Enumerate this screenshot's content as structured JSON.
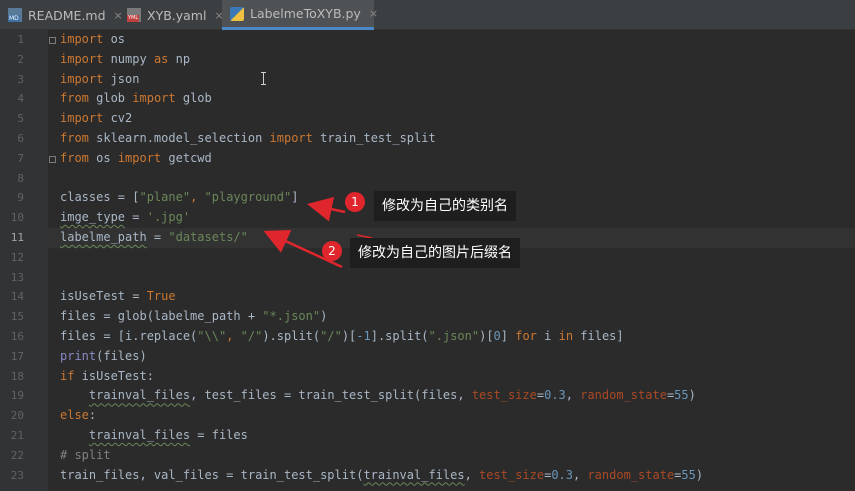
{
  "tabs": [
    {
      "label": "README.md",
      "icon": "markdown-file-icon",
      "active": false
    },
    {
      "label": "XYB.yaml",
      "icon": "yaml-file-icon",
      "active": false
    },
    {
      "label": "LabelmeToXYB.py",
      "icon": "python-file-icon",
      "active": true
    }
  ],
  "tab_close_glyph": "×",
  "line_numbers": [
    "1",
    "2",
    "3",
    "4",
    "5",
    "6",
    "7",
    "8",
    "9",
    "10",
    "11",
    "12",
    "13",
    "14",
    "15",
    "16",
    "17",
    "18",
    "19",
    "20",
    "21",
    "22",
    "23"
  ],
  "current_line": 11,
  "code": {
    "l1": {
      "kw1": "import",
      "t1": " os"
    },
    "l2": {
      "kw1": "import",
      "t1": " numpy ",
      "kw2": "as",
      "t2": " np"
    },
    "l3": {
      "kw1": "import",
      "t1": " json"
    },
    "l4": {
      "kw1": "from",
      "t1": " glob ",
      "kw2": "import",
      "t2": " glob"
    },
    "l5": {
      "kw1": "import",
      "t1": " cv2"
    },
    "l6": {
      "kw1": "from",
      "t1": " sklearn.model_selection ",
      "kw2": "import",
      "t2": " train_test_split"
    },
    "l7": {
      "kw1": "from",
      "t1": " os ",
      "kw2": "import",
      "t2": " getcwd"
    },
    "l9": {
      "t1": "classes = [",
      "s1": "\"plane\"",
      "p1": ", ",
      "s2": "\"playground\"",
      "t2": "]"
    },
    "l10": {
      "t1": "imge_type",
      "t2": " = ",
      "s1": "'.jpg'"
    },
    "l11": {
      "t1": "labelme_path",
      "t2": " = ",
      "s1": "\"datasets/\""
    },
    "l14": {
      "t1": "isUseTest = ",
      "kw1": "True"
    },
    "l15": {
      "t1": "files = glob(labelme_path + ",
      "s1": "\"*.json\"",
      "t2": ")"
    },
    "l16": {
      "t1": "files = [i.replace(",
      "s1": "\"\\\\\"",
      "p1": ", ",
      "s2": "\"/\"",
      "t2": ").split(",
      "s3": "\"/\"",
      "t3": ")[",
      "n1": "-1",
      "t4": "].split(",
      "s4": "\".json\"",
      "t5": ")[",
      "n2": "0",
      "t6": "] ",
      "kw1": "for",
      "t7": " i ",
      "kw2": "in",
      "t8": " files]"
    },
    "l17": {
      "b1": "print",
      "t1": "(files)"
    },
    "l18": {
      "kw1": "if",
      "t1": " isUseTest:"
    },
    "l19": {
      "i1": "    ",
      "t1": "trainval_files",
      "t2": ", test_files = train_test_split(files, ",
      "kw1": "test_size",
      "t3": "=",
      "n1": "0.3",
      "t4": ", ",
      "kw2": "random_state",
      "t5": "=",
      "n2": "55",
      "t6": ")"
    },
    "l20": {
      "kw1": "else",
      "t1": ":"
    },
    "l21": {
      "i1": "    ",
      "t1": "trainval_files",
      "t2": " = files"
    },
    "l22": {
      "c1": "# split"
    },
    "l23": {
      "t1": "train_files, val_files = train_test_split(",
      "t2": "trainval_files",
      "t3": ", ",
      "kw1": "test_size",
      "t4": "=",
      "n1": "0.3",
      "t5": ", ",
      "kw2": "random_state",
      "t6": "=",
      "n2": "55",
      "t7": ")"
    }
  },
  "annotations": [
    {
      "number": "1",
      "text": "修改为自己的类别名"
    },
    {
      "number": "2",
      "text": "修改为自己的图片后缀名"
    }
  ],
  "colors": {
    "keyword": "#cc7832",
    "string": "#6a8759",
    "number": "#6897bb",
    "kwarg": "#aa4926",
    "builtin": "#8888c6",
    "comment": "#808080",
    "annotation_red": "#e0262d"
  }
}
